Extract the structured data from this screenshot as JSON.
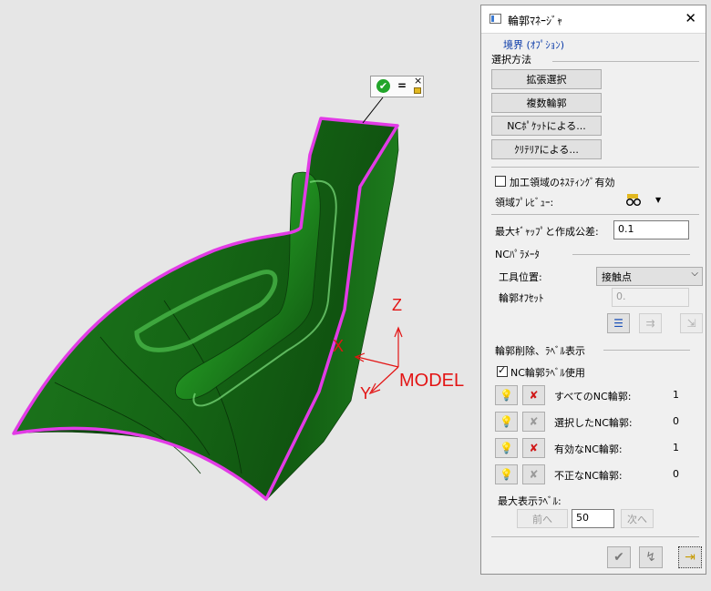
{
  "viewport": {
    "axis_z": "Z",
    "axis_x": "X",
    "axis_y": "Y",
    "model_label": "MODEL",
    "popup_equals": "=",
    "popup_close": "×",
    "colors": {
      "surface": "#1a6e1a",
      "boundary": "#e23be6",
      "axis": "#e31414"
    }
  },
  "dialog": {
    "title": "輪郭ﾏﾈｰｼﾞｬ",
    "close": "✕",
    "boundary_heading": "境界 (ｵﾌﾟｼｮﾝ)",
    "selection_method": "選択方法",
    "buttons": [
      "拡張選択",
      "複数輪郭",
      "NCﾎﾟｹｯﾄによる...",
      "ｸﾘﾃﾘｱによる..."
    ],
    "nesting_label": "加工領域のﾈｽﾃｨﾝｸﾞ有効",
    "nesting_checked": false,
    "preview_label": "領域ﾌﾟﾚﾋﾞｭｰ:",
    "max_gap_label": "最大ｷﾞｬｯﾌﾟと作成公差:",
    "max_gap_value": "0.1",
    "nc_params": "NCﾊﾟﾗﾒｰﾀ",
    "tool_position_label": "工具位置:",
    "tool_position_value": "接触点",
    "contour_offset_label": "輪郭ｵﾌｾｯﾄ",
    "contour_offset_value": "0.",
    "delete_label_section": "輪郭削除、ﾗﾍﾞﾙ表示",
    "use_label": "NC輪郭ﾗﾍﾞﾙ使用",
    "use_label_checked": true,
    "rows": [
      {
        "label": "すべてのNC輪郭:",
        "count": "1"
      },
      {
        "label": "選択したNC輪郭:",
        "count": "0"
      },
      {
        "label": "有効なNC輪郭:",
        "count": "1"
      },
      {
        "label": "不正なNC輪郭:",
        "count": "0"
      }
    ],
    "max_label": "最大表示ﾗﾍﾞﾙ:",
    "prev": "前へ",
    "max_value": "50",
    "next": "次へ"
  }
}
